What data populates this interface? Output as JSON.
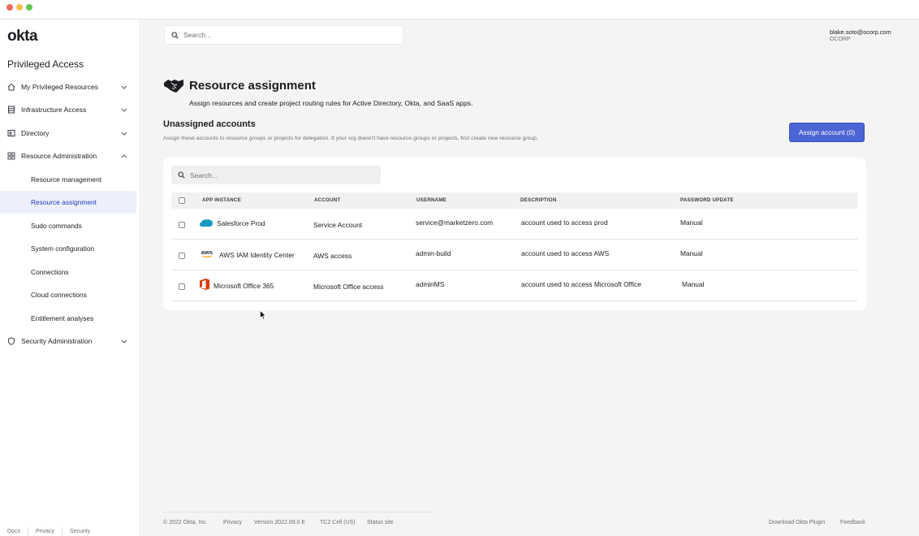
{
  "window": {
    "controls": [
      "close",
      "minimize",
      "maximize"
    ]
  },
  "brand": {
    "logo_text": "okta",
    "section_title": "Privileged Access"
  },
  "sidebar": {
    "items": [
      {
        "label": "My Privileged Resources",
        "icon": "home-icon",
        "expanded": false
      },
      {
        "label": "Infrastructure Access",
        "icon": "server-icon",
        "expanded": false
      },
      {
        "label": "Directory",
        "icon": "directory-icon",
        "expanded": false
      },
      {
        "label": "Resource Administration",
        "icon": "grid-icon",
        "expanded": true
      },
      {
        "label": "Security Administration",
        "icon": "shield-icon",
        "expanded": false
      }
    ],
    "sub_items": [
      {
        "label": "Resource management",
        "active": false
      },
      {
        "label": "Resource assignment",
        "active": true
      },
      {
        "label": "Sudo commands",
        "active": false
      },
      {
        "label": "System configuration",
        "active": false
      },
      {
        "label": "Connections",
        "active": false
      },
      {
        "label": "Cloud connections",
        "active": false
      },
      {
        "label": "Entitlement analyses",
        "active": false
      }
    ],
    "footer_links": [
      "Docs",
      "Privacy",
      "Security"
    ]
  },
  "header": {
    "search_placeholder": "Search...",
    "user_email": "blake.soto@ocorp.com",
    "user_org": "OCORP"
  },
  "page": {
    "icon": "handshake-icon",
    "title": "Resource assignment",
    "subtitle": "Assign resources and create project routing rules for Active Directory, Okta, and SaaS apps.",
    "section_title": "Unassigned accounts",
    "section_description": "Assign these accounts to resource groups or projects for delegation. If your org doesn't have resource groups or projects, first create new resource group.",
    "assign_button": "Assign account (0)"
  },
  "table": {
    "search_placeholder": "Search...",
    "columns": [
      "APP INSTANCE",
      "ACCOUNT",
      "USERNAME",
      "DESCRIPTION",
      "PASSWORD UPDATE"
    ],
    "rows": [
      {
        "app_logo": "salesforce-logo",
        "app_instance": "Salesforce Prod",
        "account": "Service Account",
        "username": "service@marketzero.com",
        "description": "account used to access prod",
        "password_update": "Manual"
      },
      {
        "app_logo": "aws-logo",
        "app_logo_text": "aws",
        "app_instance": "AWS IAM Identity Center",
        "account": "AWS access",
        "username": "admin-build",
        "description": "account used to access AWS",
        "password_update": "Manual"
      },
      {
        "app_logo": "office365-logo",
        "app_instance": "Microsoft Office 365",
        "account": "Microsoft Office access",
        "username": "adminMS",
        "description": "account used to access Microsoft Office",
        "password_update": "Manual"
      }
    ]
  },
  "footer": {
    "copyright": "© 2022 Okta, Inc.",
    "privacy": "Privacy",
    "version": "Version 2022.09.0 E",
    "cell": "TC2 Cell (US)",
    "status": "Status site",
    "download": "Download Okta Plugin",
    "feedback": "Feedback"
  },
  "colors": {
    "accent": "#4c64d4",
    "active_bg": "#edf0fa",
    "active_text": "#1e3ec2",
    "main_bg": "#f4f4f4"
  }
}
